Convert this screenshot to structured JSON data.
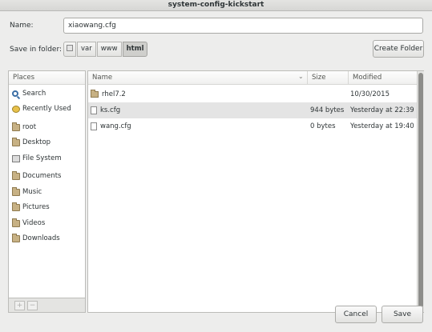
{
  "window": {
    "title": "system-config-kickstart"
  },
  "name_field": {
    "label": "Name:",
    "value": "xiaowang.cfg"
  },
  "save_in": {
    "label": "Save in folder:",
    "path": [
      "var",
      "www",
      "html"
    ],
    "active": "html"
  },
  "create_folder_label": "Create Folder",
  "places": {
    "header": "Places",
    "items": [
      {
        "label": "Search",
        "icon": "search-icon"
      },
      {
        "label": "Recently Used",
        "icon": "clock-icon"
      },
      {
        "label": "root",
        "icon": "folder-icon"
      },
      {
        "label": "Desktop",
        "icon": "folder-icon"
      },
      {
        "label": "File System",
        "icon": "drive-icon"
      },
      {
        "label": "Documents",
        "icon": "folder-icon"
      },
      {
        "label": "Music",
        "icon": "folder-icon"
      },
      {
        "label": "Pictures",
        "icon": "folder-icon"
      },
      {
        "label": "Videos",
        "icon": "folder-icon"
      },
      {
        "label": "Downloads",
        "icon": "folder-icon"
      }
    ],
    "add_label": "+",
    "remove_label": "−"
  },
  "files": {
    "columns": {
      "name": "Name",
      "size": "Size",
      "modified": "Modified"
    },
    "rows": [
      {
        "name": "rhel7.2",
        "size": "",
        "modified": "10/30/2015",
        "icon": "folder-icon"
      },
      {
        "name": "ks.cfg",
        "size": "944 bytes",
        "modified": "Yesterday at 22:39",
        "icon": "file-icon"
      },
      {
        "name": "wang.cfg",
        "size": "0 bytes",
        "modified": "Yesterday at 19:40",
        "icon": "file-icon"
      }
    ]
  },
  "footer": {
    "cancel_label": "Cancel",
    "save_label": "Save"
  }
}
